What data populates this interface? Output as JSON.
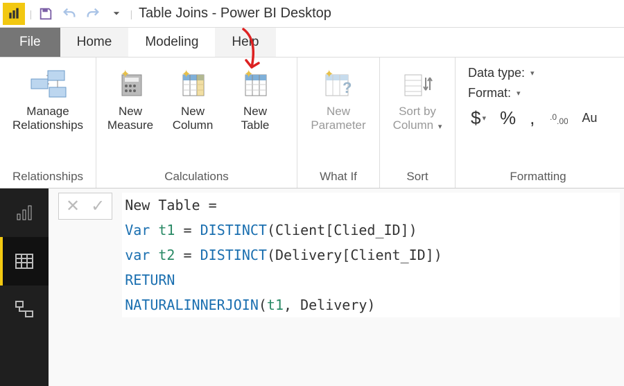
{
  "titlebar": {
    "title": "Table Joins - Power BI Desktop"
  },
  "tabs": {
    "file": "File",
    "items": [
      "Home",
      "Modeling",
      "Help"
    ],
    "active": "Modeling"
  },
  "ribbon": {
    "relationships": {
      "label": "Relationships",
      "manage": "Manage\nRelationships"
    },
    "calculations": {
      "label": "Calculations",
      "measure": "New\nMeasure",
      "column": "New\nColumn",
      "table": "New\nTable"
    },
    "whatif": {
      "label": "What If",
      "param": "New\nParameter"
    },
    "sort": {
      "label": "Sort",
      "sortby": "Sort by\nColumn"
    },
    "formatting": {
      "label": "Formatting",
      "datatype": "Data type:",
      "format": "Format:",
      "currency": "$",
      "percent": "%",
      "comma": ",",
      "decimals": ".00",
      "auto": "Au"
    }
  },
  "formula": {
    "line1_a": "New Table = ",
    "line2_a": "Var ",
    "line2_b": "t1",
    "line2_c": " = ",
    "line2_d": "DISTINCT",
    "line2_e": "(Client[Clied_ID])",
    "line3_a": "var ",
    "line3_b": "t2",
    "line3_c": " = ",
    "line3_d": "DISTINCT",
    "line3_e": "(Delivery[Client_ID])",
    "line4_a": "RETURN",
    "line5_a": "NATURALINNERJOIN",
    "line5_b": "(",
    "line5_c": "t1",
    "line5_d": ", Delivery)"
  }
}
